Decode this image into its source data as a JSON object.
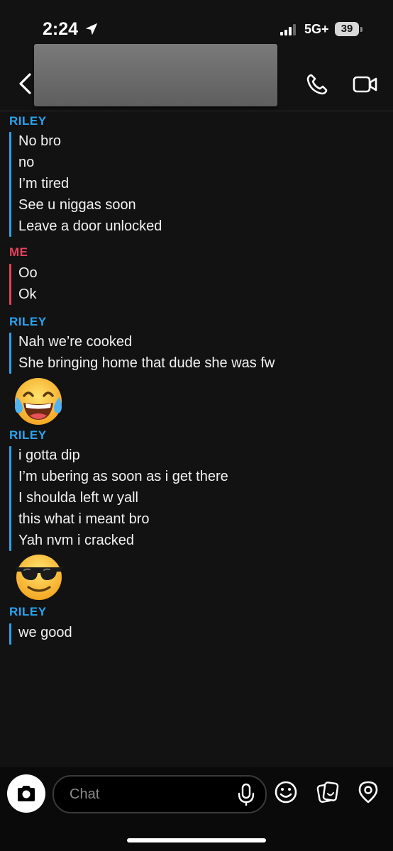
{
  "status_bar": {
    "time": "2:24",
    "network": "5G+",
    "battery": "39"
  },
  "header": {
    "back_label": "Back",
    "call_label": "Call",
    "video_label": "Video call"
  },
  "chat": {
    "groups": [
      {
        "sender": "RILEY",
        "messages": [
          "No bro",
          "no",
          "I’m tired",
          "See u niggas soon",
          "Leave a door unlocked"
        ]
      },
      {
        "sender": "ME",
        "messages": [
          "Oo",
          "Ok"
        ]
      },
      {
        "sender": "RILEY",
        "messages": [
          "Nah we’re cooked",
          "She bringing home that dude she was fw"
        ]
      },
      {
        "sender": "RILEY",
        "messages": [
          "i gotta dip",
          "I’m ubering as soon as i get there",
          "I shoulda left w yall",
          "this what i meant bro",
          "Yah nvm i cracked"
        ]
      },
      {
        "sender": "RILEY",
        "messages": [
          "we good"
        ]
      }
    ],
    "stickers": [
      "tears-of-joy-emoji",
      "sunglasses-emoji"
    ]
  },
  "composer": {
    "placeholder": "Chat"
  },
  "colors": {
    "background": "#121212",
    "riley": "#2aa4f0",
    "me": "#e8405a"
  }
}
